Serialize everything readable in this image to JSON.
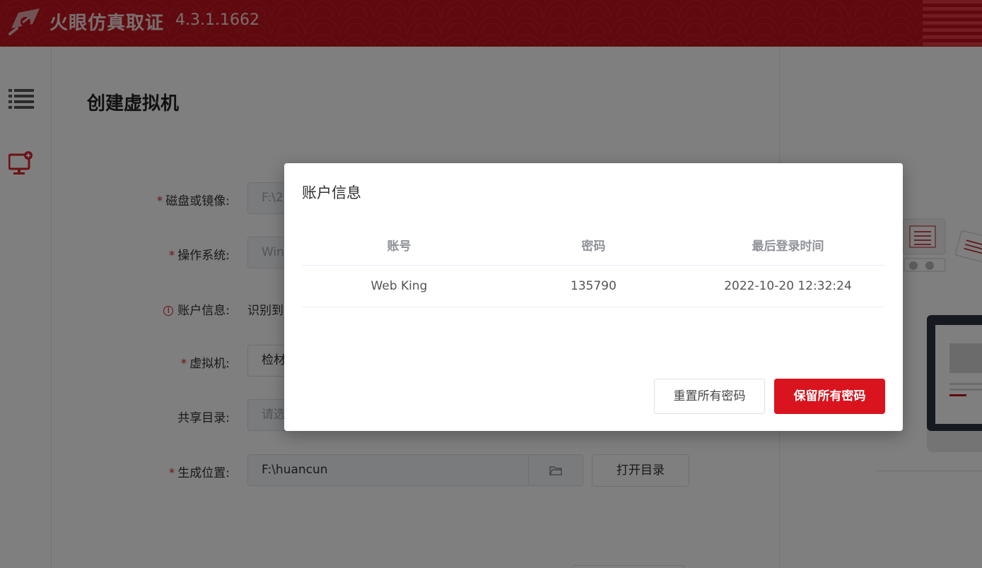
{
  "app": {
    "title": "火眼仿真取证",
    "version": "4.3.1.1662"
  },
  "sidebar": {
    "items": [
      {
        "icon": "list-icon"
      },
      {
        "icon": "add-monitor-icon"
      }
    ]
  },
  "main": {
    "page_title": "创建虚拟机",
    "fields": {
      "disk": {
        "label": "磁盘或镜像:",
        "value": "F:\\20"
      },
      "os": {
        "label": "操作系统:",
        "value": "Win"
      },
      "account": {
        "label": "账户信息:",
        "value": "识别到"
      },
      "vm": {
        "label": "虚拟机:",
        "value": "检材"
      },
      "share": {
        "label": "共享目录:",
        "placeholder": "请选"
      },
      "output": {
        "label": "生成位置:",
        "value": "F:\\huancun"
      }
    },
    "open_dir_button": "打开目录"
  },
  "dialog": {
    "title": "账户信息",
    "columns": [
      "账号",
      "密码",
      "最后登录时间"
    ],
    "rows": [
      {
        "account": "Web King",
        "password": "135790",
        "last_login": "2022-10-20 12:32:24"
      }
    ],
    "reset_button": "重置所有密码",
    "keep_button": "保留所有密码"
  },
  "colors": {
    "brand": "#c1121c",
    "primary_button": "#d9141e",
    "required": "#d9232d"
  }
}
